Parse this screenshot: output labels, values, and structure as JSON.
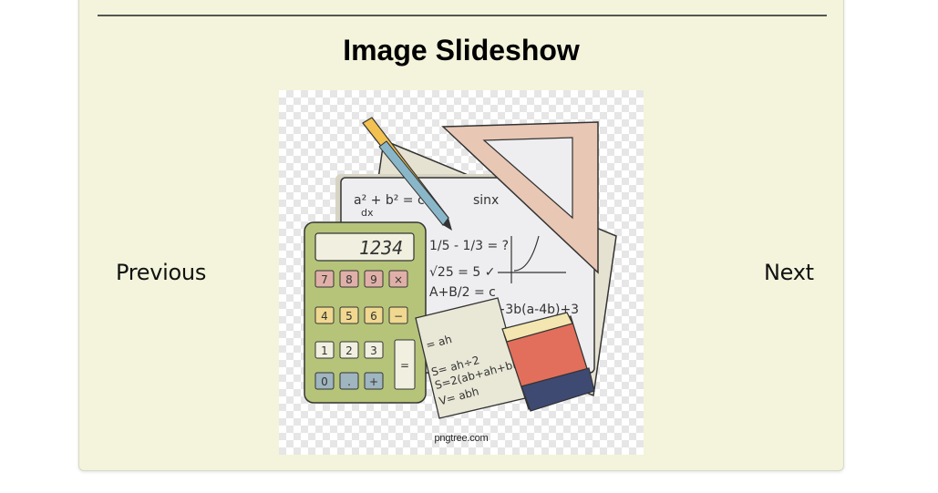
{
  "slideshow": {
    "title": "Image Slideshow",
    "prev_label": "Previous",
    "next_label": "Next",
    "image": {
      "watermark": "pngtree.com",
      "calculator_display": "1234",
      "calculator_keys": [
        "7",
        "8",
        "9",
        "×",
        "4",
        "5",
        "6",
        "−",
        "1",
        "2",
        "3",
        "=",
        "0",
        ".",
        "+"
      ],
      "board_lines": [
        "a² + b² = c",
        "dx",
        "1/5 - 1/3 = ?",
        "√25 = 5 ✓",
        "A+B / 2 = c",
        "a+3b(a-4b)+3",
        "sinx = 4 = z"
      ],
      "note_lines": [
        "= ah",
        "S= ah÷2",
        "S=2(ab+ah+bh)",
        "V= abh"
      ]
    }
  }
}
